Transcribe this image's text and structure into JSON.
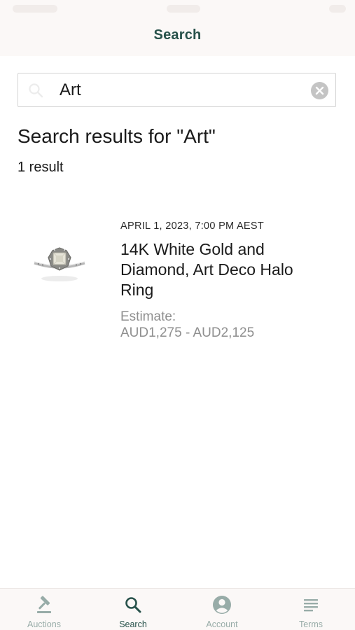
{
  "header": {
    "title": "Search"
  },
  "search": {
    "value": "Art",
    "placeholder": ""
  },
  "results": {
    "heading": "Search results for \"Art\"",
    "count_text": "1 result",
    "items": [
      {
        "date": "APRIL 1, 2023, 7:00 PM AEST",
        "title": "14K White Gold and Diamond, Art Deco Halo Ring",
        "estimate_label": "Estimate:",
        "estimate_value": "AUD1,275 - AUD2,125",
        "image": "ring-thumbnail"
      }
    ]
  },
  "tabs": [
    {
      "label": "Auctions",
      "icon": "gavel-icon",
      "active": false
    },
    {
      "label": "Search",
      "icon": "search-icon",
      "active": true
    },
    {
      "label": "Account",
      "icon": "account-icon",
      "active": false
    },
    {
      "label": "Terms",
      "icon": "terms-icon",
      "active": false
    }
  ],
  "colors": {
    "brand": "#27514a",
    "tab_inactive": "#98aca8",
    "header_bg": "#fbf8f7",
    "muted_text": "#8f8f8f"
  }
}
